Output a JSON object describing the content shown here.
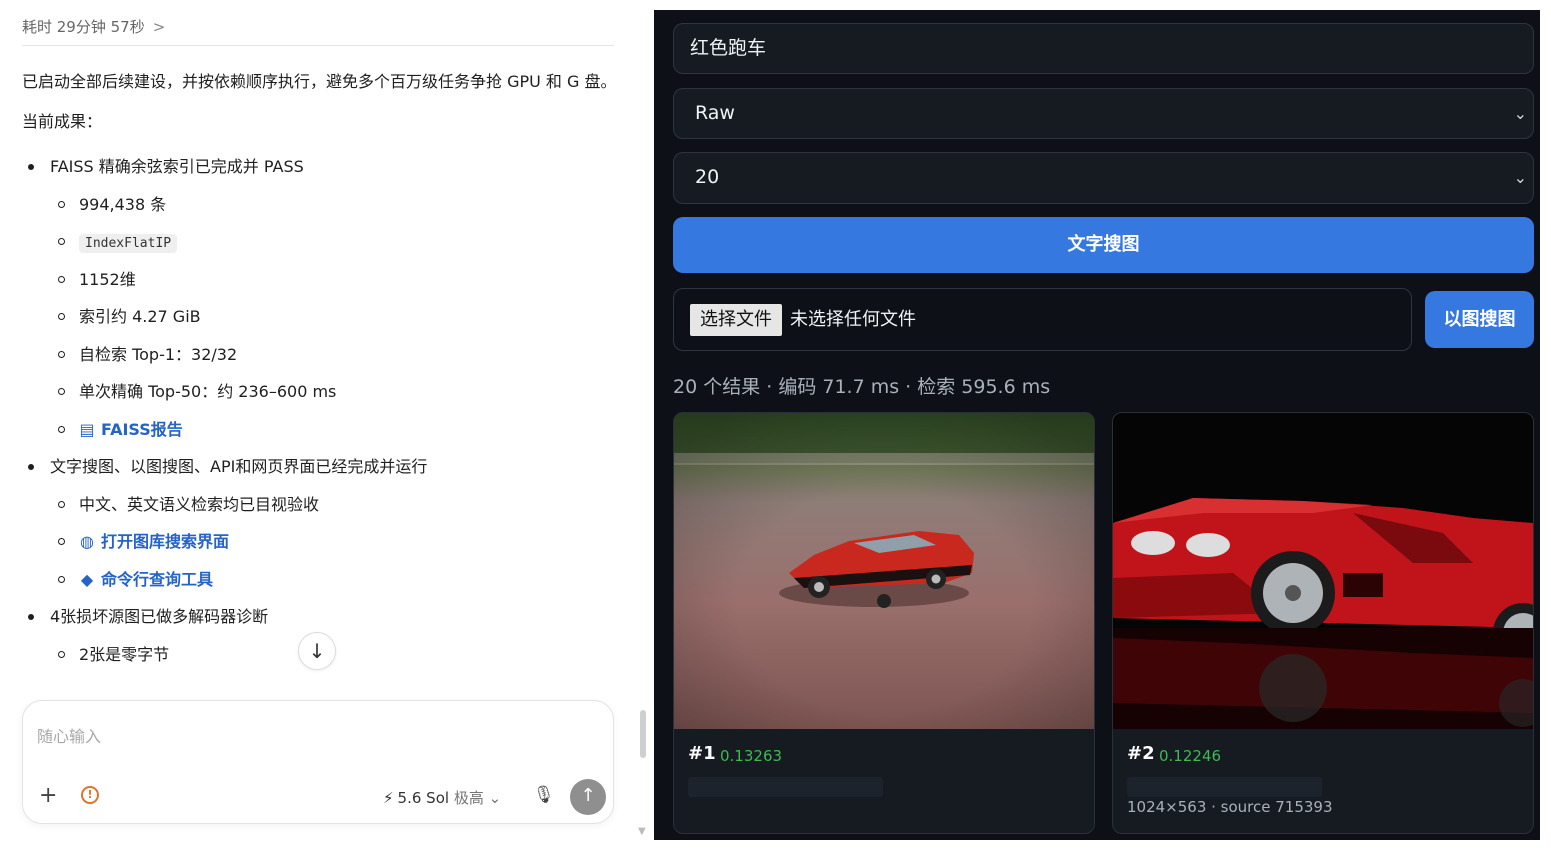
{
  "chat": {
    "elapsed": "耗时 29分钟 57秒",
    "elapsed_chevron": ">",
    "intro": "已启动全部后续建设，并按依赖顺序执行，避免多个百万级任务争抢 GPU 和 G 盘。",
    "results_heading": "当前成果：",
    "faiss": {
      "title": "FAISS 精确余弦索引已完成并 PASS",
      "count": "994,438 条",
      "index_type": "IndexFlatIP",
      "dims": "1152维",
      "size": "索引约 4.27 GiB",
      "self_check": "自检索 Top-1：32/32",
      "latency": "单次精确 Top-50：约 236–600 ms",
      "report_link": "FAISS报告"
    },
    "search": {
      "title": "文字搜图、以图搜图、API和网页界面已经完成并运行",
      "verified": "中文、英文语义检索均已目视验收",
      "ui_link": "打开图库搜索界面",
      "cli_link": "命令行查询工具"
    },
    "damaged": {
      "title": "4张损坏源图已做多解码器诊断",
      "zero_bytes": "2张是零字节"
    },
    "composer": {
      "placeholder": "随心输入",
      "model": "5.6 Sol",
      "level": "极高"
    }
  },
  "search_ui": {
    "query": "红色跑车",
    "mode": "Raw",
    "top_k": "20",
    "text_search_button": "文字搜图",
    "file_choose_button": "选择文件",
    "file_status": "未选择任何文件",
    "image_search_button": "以图搜图",
    "summary": "20 个结果 · 编码 71.7 ms · 检索 595.6 ms",
    "results": [
      {
        "rank": "#1",
        "score": "0.13263",
        "meta": ""
      },
      {
        "rank": "#2",
        "score": "0.12246",
        "meta": "1024×563 · source 715393"
      }
    ]
  },
  "icons": {
    "report": "document-icon",
    "ui_link": "globe-icon",
    "cli_link": "python-icon",
    "scroll_down": "arrow-down-icon",
    "plus": "plus-icon",
    "shield": "shield-icon",
    "bolt": "lightning-icon",
    "mic": "microphone-icon",
    "send": "arrow-up-icon"
  },
  "colors": {
    "accent_blue": "#3478e0",
    "score_green": "#3fb950",
    "link_blue": "#2563c9",
    "dark_bg": "#0d1117"
  }
}
